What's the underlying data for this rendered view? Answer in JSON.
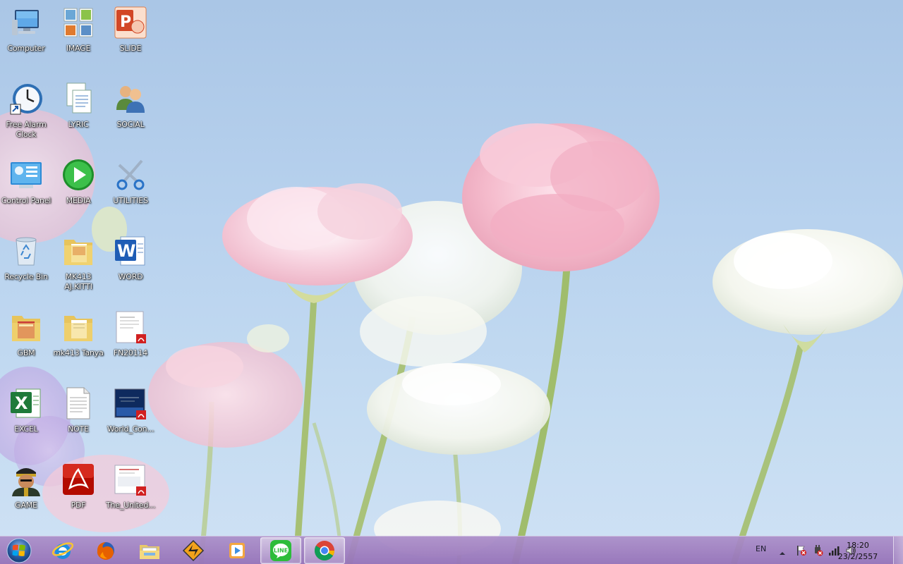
{
  "desktop": {
    "icons": [
      {
        "label": "Computer"
      },
      {
        "label": "IMAGE"
      },
      {
        "label": "SLIDE"
      },
      {
        "label": "Free Alarm Clock"
      },
      {
        "label": "LYRIC"
      },
      {
        "label": "SOCIAL"
      },
      {
        "label": "Control Panel"
      },
      {
        "label": "MEDIA"
      },
      {
        "label": "UTILITIES"
      },
      {
        "label": "Recycle Bin"
      },
      {
        "label": "MK413 AJ.KITTI"
      },
      {
        "label": "WORD"
      },
      {
        "label": "GBM"
      },
      {
        "label": "mk413 Tanya"
      },
      {
        "label": "FN20114"
      },
      {
        "label": "EXCEL"
      },
      {
        "label": "NOTE"
      },
      {
        "label": "World_Con..."
      },
      {
        "label": "GAME"
      },
      {
        "label": "PDF"
      },
      {
        "label": "The_United..."
      }
    ]
  },
  "taskbar": {
    "start": "start-orb-icon",
    "pinned": [
      {
        "icon": "internet-explorer-icon"
      },
      {
        "icon": "firefox-icon"
      },
      {
        "icon": "file-explorer-icon"
      },
      {
        "icon": "winamp-icon"
      },
      {
        "icon": "media-player-icon"
      },
      {
        "icon": "line-icon"
      },
      {
        "icon": "chrome-icon"
      }
    ],
    "tray": {
      "language": "EN",
      "time": "18:20",
      "date": "23/2/2557"
    }
  },
  "colors": {
    "taskbar": "#9673b9",
    "sky": "#b8d2ee",
    "line_green": "#2dbc3a"
  }
}
